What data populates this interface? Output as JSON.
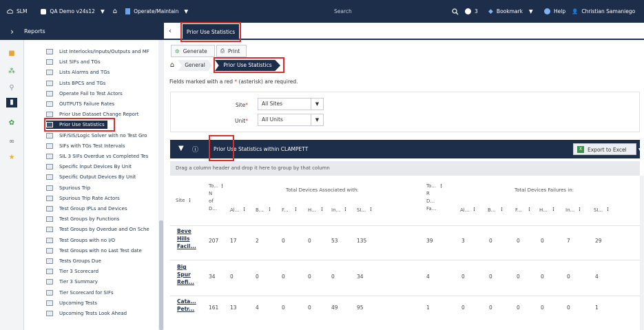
{
  "topbar": {
    "app": "SLM",
    "site": "QA Demo v24s12",
    "module": "Operate/Maintain",
    "search_placeholder": "Search",
    "notifications": "3",
    "bookmark": "Bookmark",
    "help": "Help",
    "user": "Christian Samaniego"
  },
  "sidebar": {
    "title": "Reports",
    "icons": [
      "box-icon",
      "hierarchy-icon",
      "search-icon",
      "book-icon",
      "gear-icon",
      "glasses-icon",
      "star-icon"
    ],
    "items": [
      "List Interlocks/Inputs/Outputs and MF",
      "List SIFs and TGs",
      "Lists Alarms and TGs",
      "Lists BPCS and TGs",
      "Operate Fail to Test Actors",
      "OUTPUTS Failure Rates",
      "Prior Use Dataset Change Report",
      "Prior Use Statistics",
      "SIF/SIS/Logic Solver with no Test Gro",
      "SIFs with TGs Test Intervals",
      "SIL 3 SIFs Overdue vs Completed Tes",
      "Specific Input Devices By Unit",
      "Specific Output Devices By Unit",
      "Spurious Trip",
      "Spurious Trip Rate Actors",
      "Test Group IPLs and Devices",
      "Test Groups by Functions",
      "Test Groups by Overdue and On Sche",
      "Test Groups with no I/O",
      "Test Groups with no Last Test date",
      "Tests Groups Due",
      "Tier 3 Scorecard",
      "Tier 3 Summary",
      "Tier Scorecard for SIFs",
      "Upcoming Tests",
      "Upcoming Tests Look Ahead"
    ],
    "selected_index": 7
  },
  "tab": {
    "label": "Prior Use Statistics"
  },
  "toolbar": {
    "generate": "Generate",
    "print": "Print"
  },
  "breadcrumb": {
    "general": "General",
    "current": "Prior Use Statistics"
  },
  "required_note": {
    "before": "Fields marked with a red",
    "star": "*",
    "after": "(asterisk) are required."
  },
  "filters": {
    "site_label": "Site",
    "site_value": "All Sites",
    "unit_label": "Unit",
    "unit_value": "All Units",
    "star": "*"
  },
  "grid": {
    "title": "Prior Use Statistics within CLAMPETT",
    "export": "Export to Excel",
    "group_hint": "Drag a column header and drop it here to group by that column",
    "headers": {
      "site": "Site",
      "total_devices": [
        "To...",
        "N",
        "of",
        "D..."
      ],
      "assoc_group": "Total Devices Associated with:",
      "assoc_cols": [
        "Al...",
        "B...",
        "F...",
        "H...",
        "In...",
        "SI..."
      ],
      "total_failures": [
        "To...",
        "R",
        "D...",
        "Fa..."
      ],
      "fail_group": "Total Devices Failures in:",
      "fail_cols": [
        "Al...",
        "B...",
        "F...",
        "H...",
        "In...",
        "SI..."
      ]
    },
    "rows": [
      {
        "site": [
          "Beve",
          "Hills",
          "Facil..."
        ],
        "total": "207",
        "assoc": [
          "17",
          "2",
          "0",
          "0",
          "53",
          "135"
        ],
        "fail_total": "39",
        "fail": [
          "3",
          "0",
          "0",
          "0",
          "7",
          "29"
        ]
      },
      {
        "site": [
          "Big",
          "Spur",
          "Refi..."
        ],
        "total": "34",
        "assoc": [
          "0",
          "0",
          "0",
          "0",
          "0",
          "34"
        ],
        "fail_total": "4",
        "fail": [
          "0",
          "0",
          "0",
          "0",
          "0",
          "4"
        ]
      },
      {
        "site": [
          "Cata...",
          "Petr..."
        ],
        "total": "161",
        "assoc": [
          "13",
          "4",
          "0",
          "0",
          "49",
          "95"
        ],
        "fail_total": "1",
        "fail": [
          "0",
          "0",
          "0",
          "0",
          "0",
          "1"
        ]
      }
    ]
  },
  "colors": {
    "navy": "#1d2e4a",
    "highlight": "#e02b2b"
  }
}
